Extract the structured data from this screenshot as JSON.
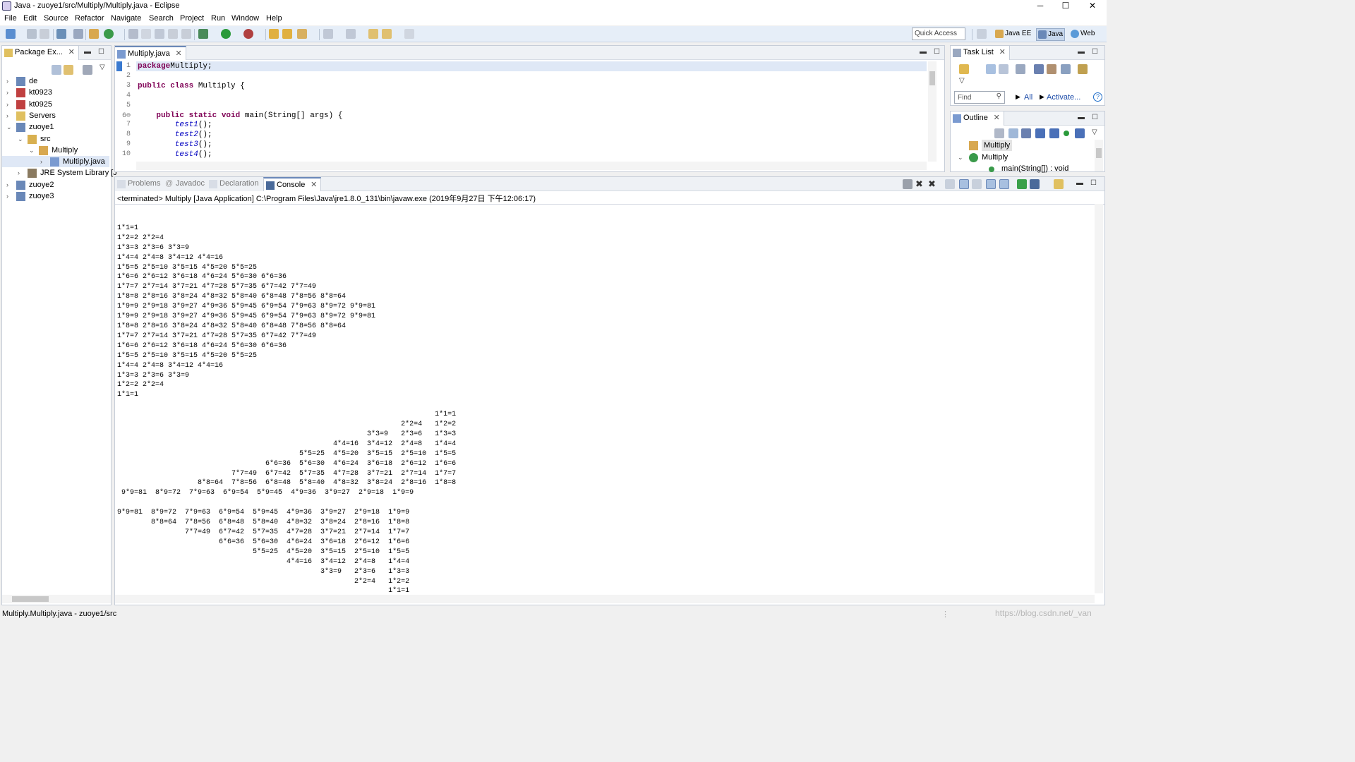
{
  "window": {
    "title": "Java - zuoye1/src/Multiply/Multiply.java - Eclipse",
    "min": "─",
    "max": "☐",
    "close": "✕"
  },
  "menu": [
    "File",
    "Edit",
    "Source",
    "Refactor",
    "Navigate",
    "Search",
    "Project",
    "Run",
    "Window",
    "Help"
  ],
  "toolbar": {
    "quick_access": "Quick Access",
    "perspectives": [
      "Java EE",
      "Java",
      "Web"
    ]
  },
  "package_explorer": {
    "tab": "Package Ex...",
    "items": [
      {
        "label": "de",
        "indent": 0,
        "expand": "›",
        "icon": "project"
      },
      {
        "label": "kt0923",
        "indent": 0,
        "expand": "›",
        "icon": "project-error"
      },
      {
        "label": "kt0925",
        "indent": 0,
        "expand": "›",
        "icon": "project-error"
      },
      {
        "label": "Servers",
        "indent": 0,
        "expand": "›",
        "icon": "folder"
      },
      {
        "label": "zuoye1",
        "indent": 0,
        "expand": "⌄",
        "icon": "project"
      },
      {
        "label": "src",
        "indent": 1,
        "expand": "⌄",
        "icon": "source-folder"
      },
      {
        "label": "Multiply",
        "indent": 2,
        "expand": "⌄",
        "icon": "package"
      },
      {
        "label": "Multiply.java",
        "indent": 3,
        "expand": "›",
        "icon": "java-file"
      },
      {
        "label": "JRE System Library [J",
        "indent": 1,
        "expand": "›",
        "icon": "library"
      },
      {
        "label": "zuoye2",
        "indent": 0,
        "expand": "›",
        "icon": "project"
      },
      {
        "label": "zuoye3",
        "indent": 0,
        "expand": "›",
        "icon": "project"
      }
    ]
  },
  "editor": {
    "tab": "Multiply.java",
    "lines": [
      {
        "n": "1",
        "parts": [
          [
            "kw",
            "package"
          ],
          [
            "",
            "Multiply;"
          ]
        ]
      },
      {
        "n": "2",
        "parts": []
      },
      {
        "n": "3",
        "parts": [
          [
            "kw",
            "public class"
          ],
          [
            "",
            " Multiply {"
          ]
        ]
      },
      {
        "n": "4",
        "parts": []
      },
      {
        "n": "5",
        "parts": []
      },
      {
        "n": "6⊖",
        "parts": [
          [
            "",
            "    "
          ],
          [
            "kw",
            "public static void"
          ],
          [
            "",
            " main(String[] args) {"
          ]
        ]
      },
      {
        "n": "7",
        "parts": [
          [
            "",
            "        "
          ],
          [
            "it",
            "test1"
          ],
          [
            "",
            "();"
          ]
        ]
      },
      {
        "n": "8",
        "parts": [
          [
            "",
            "        "
          ],
          [
            "it",
            "test2"
          ],
          [
            "",
            "();"
          ]
        ]
      },
      {
        "n": "9",
        "parts": [
          [
            "",
            "        "
          ],
          [
            "it",
            "test3"
          ],
          [
            "",
            "();"
          ]
        ]
      },
      {
        "n": "10",
        "parts": [
          [
            "",
            "        "
          ],
          [
            "it",
            "test4"
          ],
          [
            "",
            "();"
          ]
        ]
      }
    ]
  },
  "task_list": {
    "tab": "Task List",
    "find_placeholder": "Find",
    "all": "All",
    "activate": "Activate..."
  },
  "outline": {
    "tab": "Outline",
    "items": [
      {
        "label": "Multiply",
        "indent": 0,
        "icon": "package"
      },
      {
        "label": "Multiply",
        "indent": 0,
        "icon": "class",
        "expand": "⌄"
      },
      {
        "label": "main(String[]) : void",
        "indent": 1,
        "icon": "method"
      }
    ]
  },
  "bottom_tabs": [
    "Problems",
    "Javadoc",
    "Declaration",
    "Console"
  ],
  "console": {
    "header": "<terminated> Multiply [Java Application] C:\\Program Files\\Java\\jre1.8.0_131\\bin\\javaw.exe (2019年9月27日 下午12:06:17)",
    "output": "\n1*1=1\n1*2=2 2*2=4\n1*3=3 2*3=6 3*3=9\n1*4=4 2*4=8 3*4=12 4*4=16\n1*5=5 2*5=10 3*5=15 4*5=20 5*5=25\n1*6=6 2*6=12 3*6=18 4*6=24 5*6=30 6*6=36\n1*7=7 2*7=14 3*7=21 4*7=28 5*7=35 6*7=42 7*7=49\n1*8=8 2*8=16 3*8=24 4*8=32 5*8=40 6*8=48 7*8=56 8*8=64\n1*9=9 2*9=18 3*9=27 4*9=36 5*9=45 6*9=54 7*9=63 8*9=72 9*9=81\n1*9=9 2*9=18 3*9=27 4*9=36 5*9=45 6*9=54 7*9=63 8*9=72 9*9=81\n1*8=8 2*8=16 3*8=24 4*8=32 5*8=40 6*8=48 7*8=56 8*8=64\n1*7=7 2*7=14 3*7=21 4*7=28 5*7=35 6*7=42 7*7=49\n1*6=6 2*6=12 3*6=18 4*6=24 5*6=30 6*6=36\n1*5=5 2*5=10 3*5=15 4*5=20 5*5=25\n1*4=4 2*4=8 3*4=12 4*4=16\n1*3=3 2*3=6 3*3=9\n1*2=2 2*2=4\n1*1=1\n\n                                                                           1*1=1\n                                                                   2*2=4   1*2=2\n                                                           3*3=9   2*3=6   1*3=3\n                                                   4*4=16  3*4=12  2*4=8   1*4=4\n                                           5*5=25  4*5=20  3*5=15  2*5=10  1*5=5\n                                   6*6=36  5*6=30  4*6=24  3*6=18  2*6=12  1*6=6\n                           7*7=49  6*7=42  5*7=35  4*7=28  3*7=21  2*7=14  1*7=7\n                   8*8=64  7*8=56  6*8=48  5*8=40  4*8=32  3*8=24  2*8=16  1*8=8\n 9*9=81  8*9=72  7*9=63  6*9=54  5*9=45  4*9=36  3*9=27  2*9=18  1*9=9\n\n9*9=81  8*9=72  7*9=63  6*9=54  5*9=45  4*9=36  3*9=27  2*9=18  1*9=9\n        8*8=64  7*8=56  6*8=48  5*8=40  4*8=32  3*8=24  2*8=16  1*8=8\n                7*7=49  6*7=42  5*7=35  4*7=28  3*7=21  2*7=14  1*7=7\n                        6*6=36  5*6=30  4*6=24  3*6=18  2*6=12  1*6=6\n                                5*5=25  4*5=20  3*5=15  2*5=10  1*5=5\n                                        4*4=16  3*4=12  2*4=8   1*4=4\n                                                3*3=9   2*3=6   1*3=3\n                                                        2*2=4   1*2=2\n                                                                1*1=1"
  },
  "status": {
    "left": "Multiply.Multiply.java - zuoye1/src",
    "watermark": "https://blog.csdn.net/_van"
  },
  "colors": {
    "toolbar_bg": "#e6eef8",
    "keyword": "#7f0055",
    "method_call": "#0000c0",
    "selection": "#dfe8f6"
  }
}
